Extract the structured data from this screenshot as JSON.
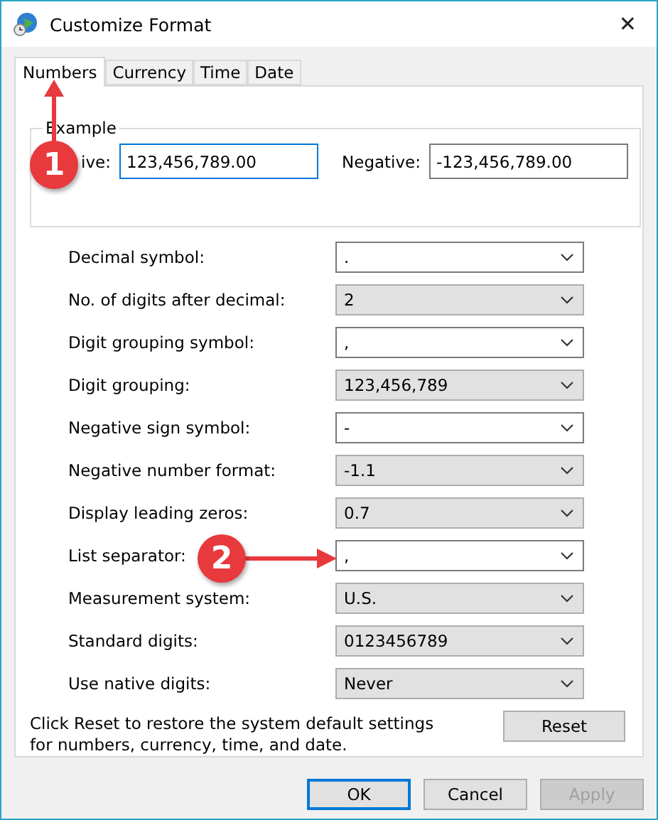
{
  "window": {
    "title": "Customize Format",
    "close": "✕"
  },
  "tabs": [
    {
      "label": "Numbers",
      "selected": true
    },
    {
      "label": "Currency",
      "selected": false
    },
    {
      "label": "Time",
      "selected": false
    },
    {
      "label": "Date",
      "selected": false
    }
  ],
  "example": {
    "legend": "Example",
    "positive_label": "ive:",
    "positive_value": "123,456,789.00",
    "positive_focused": true,
    "negative_label": "Negative:",
    "negative_value": "-123,456,789.00",
    "negative_focused": false
  },
  "settings": [
    {
      "label": "Decimal symbol:",
      "value": ".",
      "kind": "combo"
    },
    {
      "label": "No. of digits after decimal:",
      "value": "2",
      "kind": "list"
    },
    {
      "label": "Digit grouping symbol:",
      "value": ",",
      "kind": "combo"
    },
    {
      "label": "Digit grouping:",
      "value": "123,456,789",
      "kind": "list"
    },
    {
      "label": "Negative sign symbol:",
      "value": "-",
      "kind": "combo"
    },
    {
      "label": "Negative number format:",
      "value": "-1.1",
      "kind": "list"
    },
    {
      "label": "Display leading zeros:",
      "value": "0.7",
      "kind": "list"
    },
    {
      "label": "List separator:",
      "value": ",",
      "kind": "combo"
    },
    {
      "label": "Measurement system:",
      "value": "U.S.",
      "kind": "list"
    },
    {
      "label": "Standard digits:",
      "value": "0123456789",
      "kind": "list"
    },
    {
      "label": "Use native digits:",
      "value": "Never",
      "kind": "list"
    }
  ],
  "reset_note": "Click Reset to restore the system default settings for numbers, currency, time, and date.",
  "reset_button": "Reset",
  "buttons": [
    {
      "label": "OK",
      "kind": "default",
      "disabled": false
    },
    {
      "label": "Cancel",
      "kind": "normal",
      "disabled": false
    },
    {
      "label": "Apply",
      "kind": "normal",
      "disabled": true
    }
  ],
  "annotations": [
    {
      "number": "1",
      "kind": "up"
    },
    {
      "number": "2",
      "kind": "right"
    }
  ]
}
